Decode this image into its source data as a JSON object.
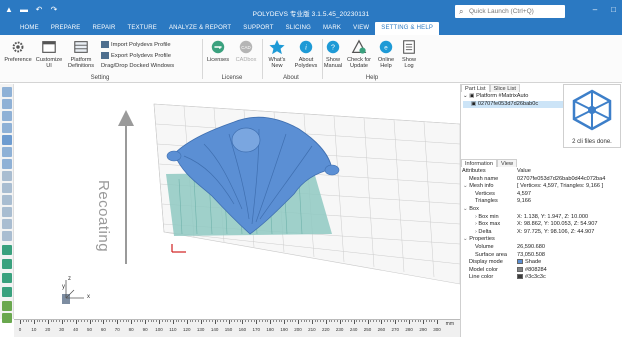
{
  "titlebar": {
    "title": "POLYDEVS 专业版 3.1.5.45_20230131",
    "quick_launch_placeholder": "Quick Launch (Ctrl+Q)"
  },
  "tabs": [
    {
      "label": "HOME"
    },
    {
      "label": "PREPARE"
    },
    {
      "label": "REPAIR"
    },
    {
      "label": "TEXTURE"
    },
    {
      "label": "ANALYZE & REPORT"
    },
    {
      "label": "SUPPORT"
    },
    {
      "label": "SLICING"
    },
    {
      "label": "MARK"
    },
    {
      "label": "VIEW"
    },
    {
      "label": "SETTING & HELP"
    }
  ],
  "ribbon": {
    "setting": {
      "group_label": "Setting",
      "preference": "Preference",
      "customize_ui_1": "Customize",
      "customize_ui_2": "UI",
      "platform_1": "Platform",
      "platform_2": "Definitions",
      "import_profile": "Import Polydevs Profile",
      "export_profile": "Export Polydevs Profile",
      "drag_drop": "Drag/Drop Docked Windows"
    },
    "license": {
      "group_label": "License",
      "licenses": "Licenses",
      "cadbox": "CADbox"
    },
    "about": {
      "group_label": "About",
      "whats_new_1": "What's",
      "whats_new_2": "New",
      "about_1": "About",
      "about_2": "Polydevs"
    },
    "help": {
      "group_label": "Help",
      "show_manual_1": "Show",
      "show_manual_2": "Manual",
      "check_update_1": "Check for",
      "check_update_2": "Update",
      "online_help_1": "Online",
      "online_help_2": "Help",
      "show_log_1": "Show",
      "show_log_2": "Log"
    }
  },
  "viewport": {
    "recoating_label": "Recoating",
    "axis_x": "x",
    "axis_y": "y",
    "axis_z": "z"
  },
  "ruler": {
    "ticks": [
      "0",
      "10",
      "20",
      "30",
      "40",
      "50",
      "60",
      "70",
      "80",
      "90",
      "100",
      "110",
      "120",
      "130",
      "140",
      "150",
      "160",
      "170",
      "180",
      "190",
      "200",
      "210",
      "220",
      "230",
      "240",
      "250",
      "260",
      "270",
      "280",
      "290",
      "300"
    ],
    "unit": "mm"
  },
  "right_panel": {
    "tab_part_list": "Part List",
    "tab_slice_list": "Slice List",
    "tree_platform": "Platform #MatrixAuto",
    "tree_part": "02707fe053d7d26bab0c",
    "preview_caption": "2 cli files done.",
    "tab_information": "Information",
    "tab_view": "View",
    "col_attributes": "Attributes",
    "col_value": "Value",
    "rows": [
      {
        "k": "Mesh name",
        "v": "02707fe053d7d26bab0d44c072ba4",
        "indent": 1
      },
      {
        "k": "Mesh info",
        "v": "[ Vertices: 4,597, Triangles: 9,166 ]",
        "indent": 0,
        "twisty": "⌄"
      },
      {
        "k": "Vertices",
        "v": "4,597",
        "indent": 2
      },
      {
        "k": "Triangles",
        "v": "9,166",
        "indent": 2
      },
      {
        "k": "Box",
        "v": "",
        "indent": 0,
        "twisty": "⌄"
      },
      {
        "k": "Box min",
        "v": "X: 1.138, Y: 1.947, Z: 10.000",
        "indent": 2,
        "twisty": "›"
      },
      {
        "k": "Box max",
        "v": "X: 98.862, Y: 100.053, Z: 54.907",
        "indent": 2,
        "twisty": "›"
      },
      {
        "k": "Delta",
        "v": "X: 97.725, Y: 98.106, Z: 44.907",
        "indent": 2,
        "twisty": "›"
      },
      {
        "k": "Properties",
        "v": "",
        "indent": 0,
        "twisty": "⌄"
      },
      {
        "k": "Volume",
        "v": "26,590.680",
        "indent": 2
      },
      {
        "k": "Surface area",
        "v": "73,050.508",
        "indent": 2
      },
      {
        "k": "Display mode",
        "v": "Shade",
        "indent": 1,
        "swatch": "#5b8fd4"
      },
      {
        "k": "Model color",
        "v": "#808284",
        "indent": 1,
        "swatch": "#808284"
      },
      {
        "k": "Line color",
        "v": "#3c3c3c",
        "indent": 1,
        "swatch": "#3c3c3c"
      }
    ]
  },
  "colors": {
    "accent": "#2b79c2",
    "model": "#5b8fd4",
    "support": "#8fc9c2"
  }
}
